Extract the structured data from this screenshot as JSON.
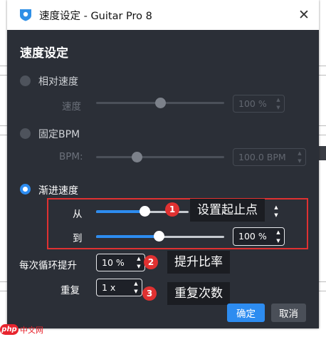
{
  "window": {
    "title": "速度设定 - Guitar Pro 8",
    "close_glyph": "✕"
  },
  "heading": "速度设定",
  "relative_speed": {
    "label": "相对速度",
    "speed_label": "速度",
    "value": "100 %",
    "slider_level": 0.5
  },
  "fixed_bpm": {
    "label": "固定BPM",
    "bpm_label": "BPM:",
    "value": "100.0 BPM",
    "slider_level": 0.32
  },
  "progressive": {
    "label": "渐进速度",
    "from_label": "从",
    "to_label": "到",
    "from_level": 0.38,
    "to_level": 0.49,
    "to_value": "100 %",
    "increment_label": "每次循环提升",
    "increment_value": "10 %",
    "repeat_label": "重复",
    "repeat_value": "1 x"
  },
  "annotations": [
    {
      "number": "1",
      "text": "设置起止点"
    },
    {
      "number": "2",
      "text": "提升比率"
    },
    {
      "number": "3",
      "text": "重复次数"
    }
  ],
  "buttons": {
    "ok": "确定",
    "cancel": "取消"
  },
  "watermark": {
    "logo": "php",
    "text": "中文网"
  },
  "colors": {
    "accent": "#2d8cf0",
    "annotation_red": "#e03131",
    "dialog_bg": "#2b2f37"
  }
}
